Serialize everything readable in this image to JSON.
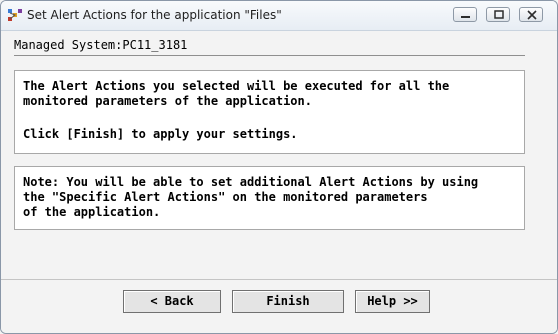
{
  "window": {
    "title": "Set Alert Actions for the application \"Files\""
  },
  "managed_system": {
    "label": "Managed System:PC11_3181"
  },
  "info_box": {
    "line1": "The Alert Actions you selected will be executed for all the",
    "line2": "monitored parameters of the application.",
    "line3": "Click [Finish] to apply your settings."
  },
  "note_box": {
    "line1": "Note: You will be able to set additional Alert Actions by using",
    "line2": "the \"Specific Alert Actions\" on the monitored parameters",
    "line3": "of the application."
  },
  "buttons": {
    "back": "< Back",
    "finish": "Finish",
    "help": "Help >>"
  },
  "icons": {
    "app": "app-icon",
    "minimize": "minimize-icon",
    "maximize": "maximize-icon",
    "close": "close-icon"
  }
}
